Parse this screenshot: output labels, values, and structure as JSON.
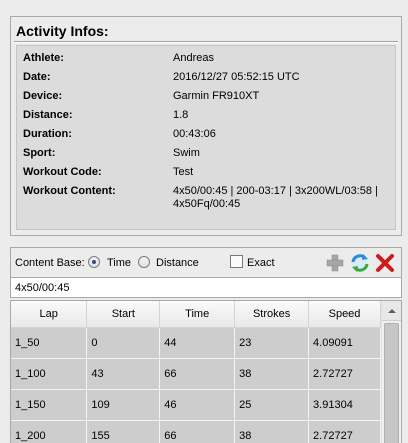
{
  "panel": {
    "title": "Activity Infos:",
    "rows": [
      {
        "label": "Athlete:",
        "value": "Andreas"
      },
      {
        "label": "Date:",
        "value": "2016/12/27 05:52:15 UTC"
      },
      {
        "label": "Device:",
        "value": "Garmin FR910XT"
      },
      {
        "label": "Distance:",
        "value": "1.8"
      },
      {
        "label": "Duration:",
        "value": "00:43:06"
      },
      {
        "label": "Sport:",
        "value": "Swim"
      },
      {
        "label": "Workout Code:",
        "value": "Test"
      },
      {
        "label": "Workout Content:",
        "value": "4x50/00:45 | 200-03:17 | 3x200WL/03:58 | 4x50Fq/00:45"
      }
    ]
  },
  "controls": {
    "content_base_label": "Content Base:",
    "time_label": "Time",
    "distance_label": "Distance",
    "exact_label": "Exact",
    "selected": "Time",
    "exact_checked": false
  },
  "filter": {
    "value": "4x50/00:45"
  },
  "table": {
    "headers": [
      "Lap",
      "Start",
      "Time",
      "Strokes",
      "Speed"
    ],
    "rows": [
      [
        "1_50",
        "0",
        "44",
        "23",
        "4.09091"
      ],
      [
        "1_100",
        "43",
        "66",
        "38",
        "2.72727"
      ],
      [
        "1_150",
        "109",
        "46",
        "25",
        "3.91304"
      ],
      [
        "1_200",
        "155",
        "66",
        "38",
        "2.72727"
      ]
    ]
  },
  "colors": {
    "add": "#a6a6a6",
    "refresh": "#2e8ad6",
    "delete": "#d11a1a"
  }
}
